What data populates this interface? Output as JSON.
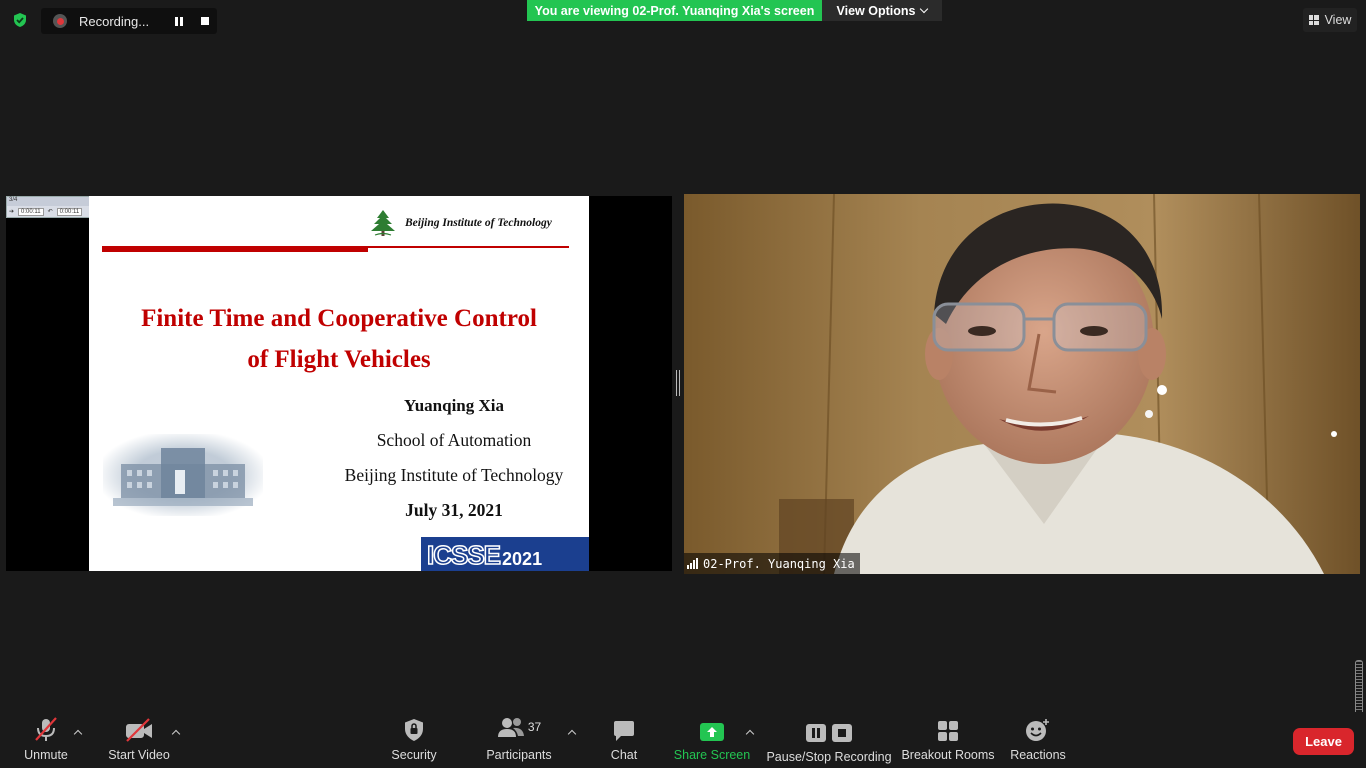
{
  "top": {
    "recording_label": "Recording...",
    "viewing_banner": "You are viewing 02-Prof. Yuanqing Xia's screen",
    "view_options_label": "View Options",
    "view_label": "View"
  },
  "slide": {
    "mini_control": {
      "title": "3/4",
      "time_left": "0:00:11",
      "time_right": "0:00:11"
    },
    "institute_logo": "Beijing Institute of Technology",
    "title_line1": "Finite Time and Cooperative Control",
    "title_line2": "of Flight Vehicles",
    "author": "Yuanqing Xia",
    "school": "School of Automation",
    "institute": "Beijing Institute of Technology",
    "date": "July 31, 2021",
    "conference_logo": "ICSSE",
    "conference_year": "2021"
  },
  "video": {
    "participant_name": "02-Prof. Yuanqing Xia"
  },
  "toolbar": {
    "unmute": "Unmute",
    "start_video": "Start Video",
    "security": "Security",
    "participants": "Participants",
    "participants_count": "37",
    "chat": "Chat",
    "share_screen": "Share Screen",
    "pause_stop_recording": "Pause/Stop Recording",
    "breakout_rooms": "Breakout Rooms",
    "reactions": "Reactions",
    "leave": "Leave"
  },
  "colors": {
    "accent_green": "#23c552",
    "leave_red": "#d9262c",
    "slide_title_red": "#c00000",
    "background": "#1a1a1a"
  }
}
